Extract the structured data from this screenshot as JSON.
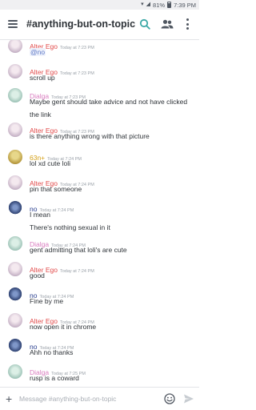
{
  "status_bar": {
    "battery": "81%",
    "time": "7:39 PM"
  },
  "header": {
    "channel_title": "#anything-but-on-topic"
  },
  "colors": {
    "Alter Ego": "#e24b4b",
    "Dialga": "#d97bbf",
    "63n+": "#d4a017",
    "no": "#2a3f8f",
    "mention_text": "#5f7ac7"
  },
  "messages": [
    {
      "author": "Alter Ego",
      "timestamp": "Today at 7:23 PM",
      "lines": [
        "@no"
      ]
    },
    {
      "author": "Alter Ego",
      "timestamp": "Today at 7:23 PM",
      "lines": [
        "scroll up"
      ]
    },
    {
      "author": "Dialga",
      "timestamp": "Today at 7:23 PM",
      "lines": [
        "Maybe gent should take advice and not have clicked",
        "the link"
      ]
    },
    {
      "author": "Alter Ego",
      "timestamp": "Today at 7:23 PM",
      "lines": [
        "is there anything wrong with that picture"
      ]
    },
    {
      "author": "63n+",
      "timestamp": "Today at 7:24 PM",
      "lines": [
        "lol xd cute loli"
      ]
    },
    {
      "author": "Alter Ego",
      "timestamp": "Today at 7:24 PM",
      "lines": [
        "pin that someone"
      ]
    },
    {
      "author": "no",
      "timestamp": "Today at 7:24 PM",
      "lines": [
        "I mean",
        "There's nothing sexual in it"
      ]
    },
    {
      "author": "Dialga",
      "timestamp": "Today at 7:24 PM",
      "lines": [
        "gent admitting that loli's are cute"
      ]
    },
    {
      "author": "Alter Ego",
      "timestamp": "Today at 7:24 PM",
      "lines": [
        "good"
      ]
    },
    {
      "author": "no",
      "timestamp": "Today at 7:24 PM",
      "lines": [
        "Fine by me"
      ]
    },
    {
      "author": "Alter Ego",
      "timestamp": "Today at 7:24 PM",
      "lines": [
        "now open it in chrome"
      ]
    },
    {
      "author": "no",
      "timestamp": "Today at 7:24 PM",
      "lines": [
        "Ahh no thanks"
      ]
    },
    {
      "author": "Dialga",
      "timestamp": "Today at 7:25 PM",
      "lines": [
        "rusp is a coward"
      ]
    }
  ],
  "composer": {
    "placeholder": "Message #anything-but-on-topic"
  }
}
